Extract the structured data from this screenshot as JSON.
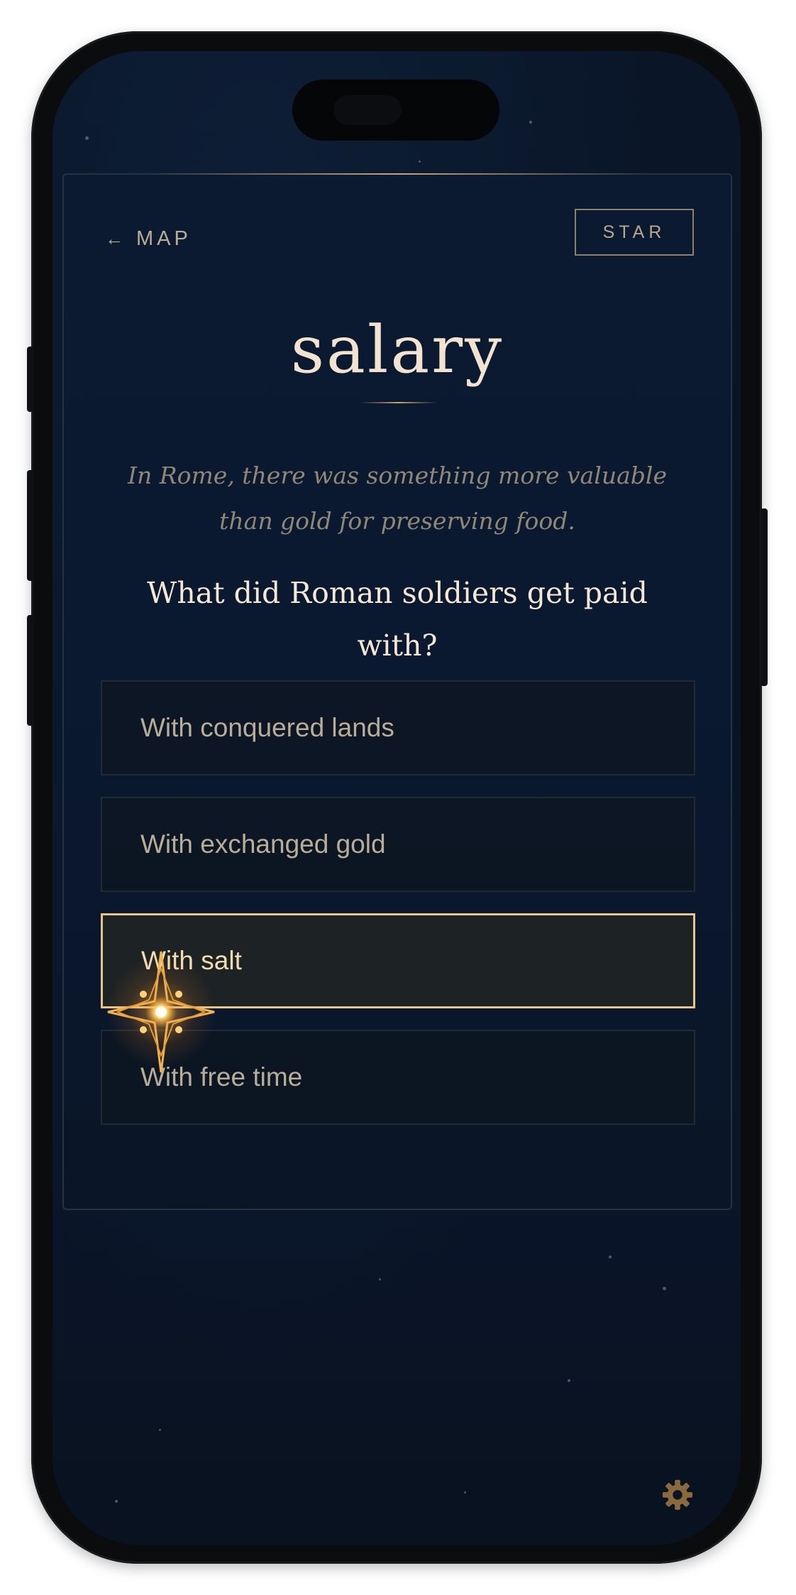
{
  "nav": {
    "back_arrow": "←",
    "back_label": "MAP",
    "star_label": "STAR"
  },
  "lesson": {
    "word": "salary",
    "hint": "In Rome, there was something more valuable than gold for preserving food.",
    "question": "What did Roman soldiers get paid with?"
  },
  "options": [
    {
      "label": "With conquered lands",
      "selected": false
    },
    {
      "label": "With exchanged gold",
      "selected": false
    },
    {
      "label": "With salt",
      "selected": true
    },
    {
      "label": "With free time",
      "selected": false
    }
  ],
  "icons": {
    "compass": "compass-star-icon",
    "settings": "gear-icon"
  },
  "colors": {
    "accent_gold": "#e8c48a",
    "title_cream": "#f1e3cf",
    "background_navy": "#0a1628",
    "star_glow": "#ffb347"
  }
}
